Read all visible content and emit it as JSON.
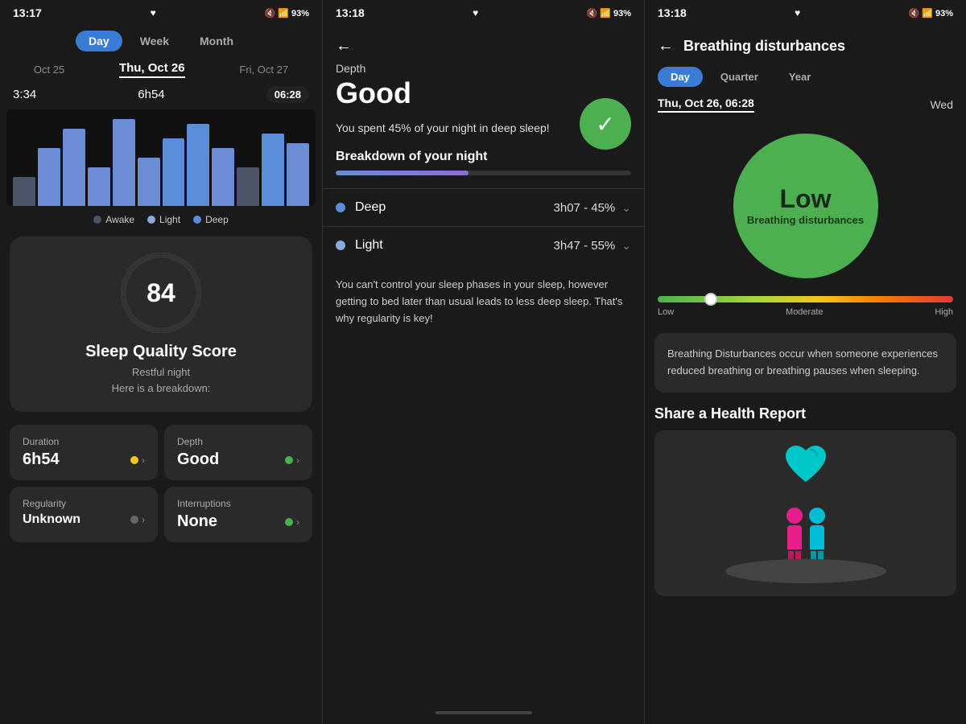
{
  "panel1": {
    "statusBar": {
      "time": "13:17",
      "battery": "93%",
      "heartIcon": "♥"
    },
    "tabs": [
      "Day",
      "Week",
      "Month"
    ],
    "activeTab": "Day",
    "dates": {
      "prev": "Oct 25",
      "current": "Thu, Oct 26",
      "next": "Fri, Oct 27"
    },
    "timeRange": {
      "start": "3:34",
      "duration": "6h54",
      "end": "06:28"
    },
    "legend": {
      "awake": "Awake",
      "light": "Light",
      "deep": "Deep"
    },
    "scoreCard": {
      "score": "84",
      "title": "Sleep Quality Score",
      "subtitle": "Restful night\nHere is a breakdown:"
    },
    "metrics": {
      "duration": {
        "label": "Duration",
        "value": "6h54",
        "indicator": "yellow"
      },
      "depth": {
        "label": "Depth",
        "value": "Good",
        "indicator": "green"
      },
      "regularity": {
        "label": "Regularity",
        "value": "Unknown",
        "indicator": "gray"
      },
      "interruptions": {
        "label": "Interruptions",
        "value": "None",
        "indicator": "green"
      }
    }
  },
  "panel2": {
    "statusBar": {
      "time": "13:18",
      "battery": "93%"
    },
    "category": "Depth",
    "title": "Good",
    "description": "You spent 45% of your night in deep sleep!",
    "sectionTitle": "Breakdown of your night",
    "stages": [
      {
        "name": "Deep",
        "value": "3h07 - 45%",
        "type": "deep"
      },
      {
        "name": "Light",
        "value": "3h47 - 55%",
        "type": "light"
      }
    ],
    "advice": "You can't control your sleep phases in your sleep, however getting to bed later than usual leads to less deep sleep. That's why regularity is key!"
  },
  "panel3": {
    "statusBar": {
      "time": "13:18",
      "battery": "93%"
    },
    "title": "Breathing disturbances",
    "tabs": [
      "Day",
      "Quarter",
      "Year"
    ],
    "activeTab": "Day",
    "date": "Thu, Oct 26, 06:28",
    "dateNext": "Wed",
    "circle": {
      "label": "Low",
      "sublabel": "Breathing disturbances"
    },
    "scale": {
      "markerPosition": "18",
      "labels": [
        "Low",
        "Moderate",
        "High"
      ]
    },
    "infoCard": {
      "text": "Breathing Disturbances occur when someone experiences reduced breathing or breathing pauses when sleeping."
    },
    "healthReport": {
      "title": "Share a Health Report"
    }
  }
}
